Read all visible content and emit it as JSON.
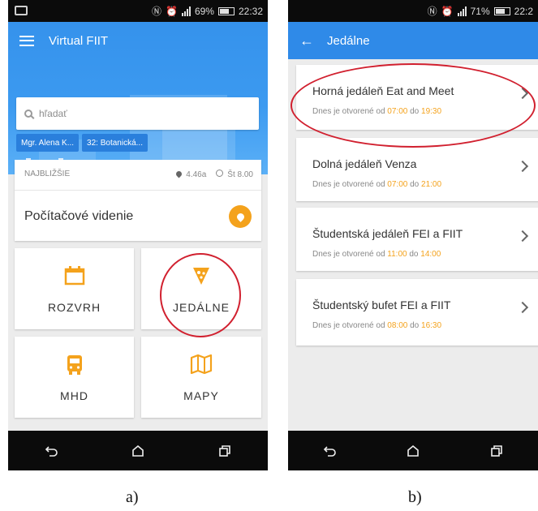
{
  "panel_a": {
    "status": {
      "battery": "69%",
      "time": "22:32"
    },
    "app_title": "Virtual FIIT",
    "search": {
      "placeholder": "hľadať"
    },
    "chips": [
      "Mgr. Alena K...",
      "32: Botanická..."
    ],
    "nearest": {
      "label": "NAJBLIŽŠIE",
      "room": "4.46a",
      "time": "Št 8.00",
      "course": "Počítačové videnie"
    },
    "tiles": [
      {
        "label": "ROZVRH",
        "icon": "calendar-icon"
      },
      {
        "label": "JEDÁLNE",
        "icon": "pizza-icon"
      },
      {
        "label": "MHD",
        "icon": "bus-icon"
      },
      {
        "label": "MAPY",
        "icon": "map-icon"
      }
    ],
    "caption": "a)"
  },
  "panel_b": {
    "status": {
      "battery": "71%",
      "time": "22:2"
    },
    "app_title": "Jedálne",
    "hours_prefix": "Dnes je otvorené od",
    "hours_mid": "do",
    "canteens": [
      {
        "name": "Horná jedáleň Eat and Meet",
        "open": "07:00",
        "close": "19:30"
      },
      {
        "name": "Dolná jedáleň Venza",
        "open": "07:00",
        "close": "21:00"
      },
      {
        "name": "Študentská jedáleň FEI a FIIT",
        "open": "11:00",
        "close": "14:00"
      },
      {
        "name": "Študentský bufet FEI a FIIT",
        "open": "08:00",
        "close": "16:30"
      }
    ],
    "caption": "b)"
  },
  "colors": {
    "primary_blue": "#2f8ae8",
    "accent_orange": "#f4a21c",
    "highlight_red": "#d1202f"
  }
}
